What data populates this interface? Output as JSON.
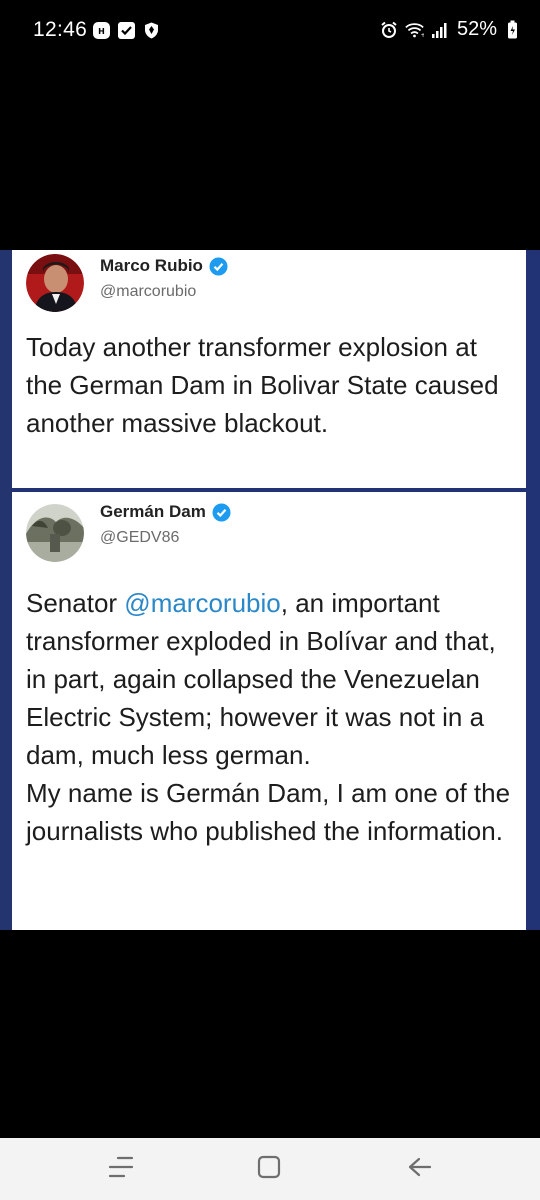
{
  "status_bar": {
    "time": "12:46",
    "battery_percent": "52%",
    "icons_left": [
      "notification-icon",
      "check-icon",
      "shield-icon"
    ],
    "icons_right": [
      "alarm-icon",
      "wifi-icon",
      "signal-icon",
      "battery-icon"
    ]
  },
  "tweets": [
    {
      "name": "Marco Rubio",
      "handle": "@marcorubio",
      "verified": true,
      "text": "Today another transformer explosion at the German Dam in Bolivar State caused another massive blackout."
    },
    {
      "name": "Germán Dam",
      "handle": "@GEDV86",
      "verified": true,
      "text_prefix": "Senator ",
      "mention": "@marcorubio",
      "text_suffix": ", an important transformer exploded in Bolívar and that, in part, again collapsed the Venezuelan Electric System; however it was not in a dam, much less german.",
      "text_second": "My name is Germán Dam, I am one of the journalists who published the information."
    }
  ],
  "colors": {
    "mention": "#2a88c9",
    "verified": "#1d9bf0",
    "frame": "#223375"
  },
  "nav_bar": {
    "buttons": [
      "recents-icon",
      "home-icon",
      "back-icon"
    ]
  }
}
